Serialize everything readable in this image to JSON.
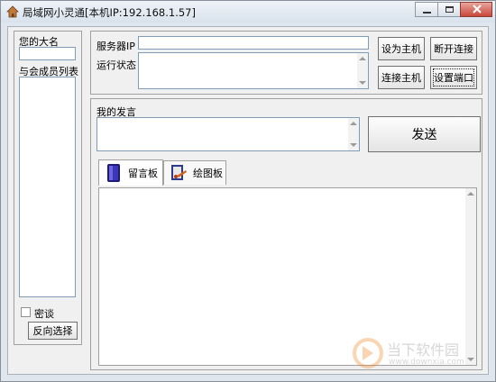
{
  "window": {
    "title": "局域网小灵通[本机IP:192.168.1.57]"
  },
  "left_panel": {
    "name_label": "您的大名",
    "name_value": "",
    "members_label": "与会成员列表",
    "private_chat_label": "密谈",
    "private_chat_checked": false,
    "reverse_select_label": "反向选择"
  },
  "server": {
    "server_ip_label": "服务器IP",
    "server_ip_value": "",
    "status_label": "运行状态",
    "status_value": "",
    "set_host_label": "设为主机",
    "disconnect_label": "断开连接",
    "connect_host_label": "连接主机",
    "set_port_label": "设置端口"
  },
  "message": {
    "speech_label": "我的发言",
    "speech_value": "",
    "send_label": "发送"
  },
  "tabs": [
    {
      "label": "留言板",
      "icon": "message-board-icon",
      "active": true
    },
    {
      "label": "绘图板",
      "icon": "drawing-board-icon",
      "active": false
    }
  ],
  "watermark": {
    "brand": "当下软件园",
    "url": "www.downxia.com"
  }
}
